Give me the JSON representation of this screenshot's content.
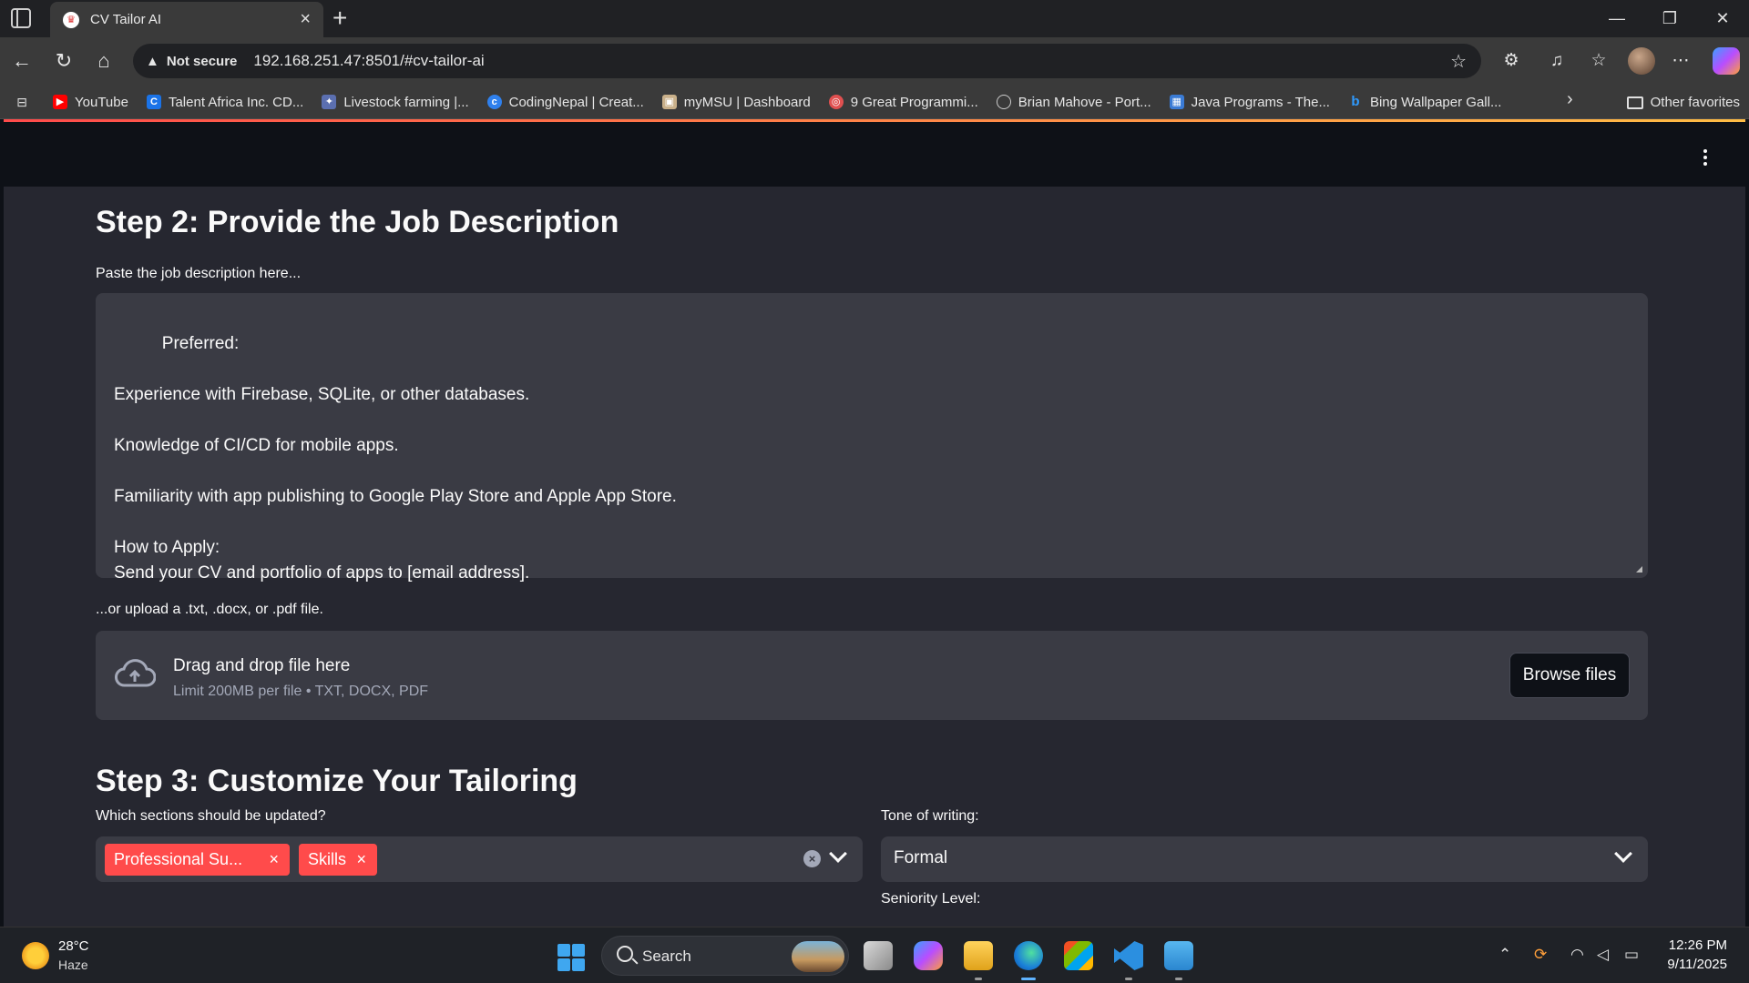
{
  "browser": {
    "tab_title": "CV Tailor AI",
    "security_label": "Not secure",
    "url": "192.168.251.47:8501/#cv-tailor-ai",
    "favorites": [
      {
        "label": "YouTube",
        "icon": "youtube-icon",
        "color": "#ff0000"
      },
      {
        "label": "Talent Africa Inc. CD...",
        "icon": "talent-africa-icon",
        "color": "#1a73e8"
      },
      {
        "label": "Livestock farming |...",
        "icon": "livestock-icon",
        "color": "#5b6fb0"
      },
      {
        "label": "CodingNepal | Creat...",
        "icon": "codingnepal-icon",
        "color": "#2f80ed"
      },
      {
        "label": "myMSU | Dashboard",
        "icon": "mymsu-icon",
        "color": "#c9b08a"
      },
      {
        "label": "9 Great Programmi...",
        "icon": "programming-icon",
        "color": "#e05050"
      },
      {
        "label": "Brian Mahove - Port...",
        "icon": "globe-icon",
        "color": "#9a9a9a"
      },
      {
        "label": "Java Programs - The...",
        "icon": "java-icon",
        "color": "#3a7bd5"
      },
      {
        "label": "Bing Wallpaper Gall...",
        "icon": "bing-icon",
        "color": "#1a73e8"
      }
    ],
    "other_favorites": "Other favorites"
  },
  "app": {
    "step2_title": "Step 2: Provide the Job Description",
    "jd_label": "Paste the job description here...",
    "jd_text": "Preferred:\n\nExperience with Firebase, SQLite, or other databases.\n\nKnowledge of CI/CD for mobile apps.\n\nFamiliarity with app publishing to Google Play Store and Apple App Store.\n\nHow to Apply:\nSend your CV and portfolio of apps to [email address].",
    "upload_label": "...or upload a .txt, .docx, or .pdf file.",
    "upload_main": "Drag and drop file here",
    "upload_sub": "Limit 200MB per file • TXT, DOCX, PDF",
    "browse_label": "Browse files",
    "step3_title": "Step 3: Customize Your Tailoring",
    "sections_label": "Which sections should be updated?",
    "sections_tags": [
      "Professional Su...",
      "Skills"
    ],
    "tone_label": "Tone of writing:",
    "tone_value": "Formal",
    "seniority_label": "Seniority Level:"
  },
  "taskbar": {
    "temperature": "28°C",
    "weather": "Haze",
    "search_label": "Search",
    "time": "12:26 PM",
    "date": "9/11/2025"
  }
}
